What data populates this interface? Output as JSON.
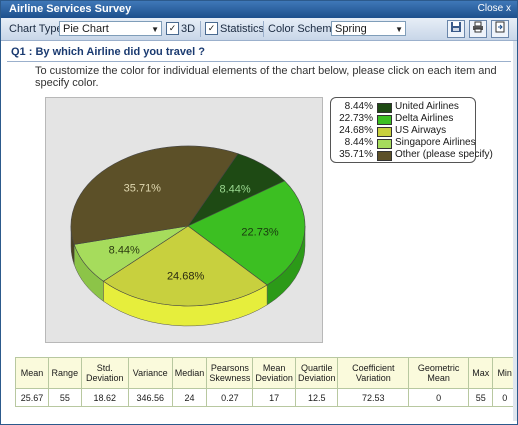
{
  "window": {
    "title": "Airline Services Survey",
    "close_label": "Close x"
  },
  "toolbar": {
    "chart_type_label": "Chart Type:",
    "chart_type_value": "Pie Chart",
    "three_d_label": "3D",
    "three_d_checked": true,
    "statistics_label": "Statistics",
    "statistics_checked": true,
    "color_scheme_label": "Color Scheme:",
    "color_scheme_value": "Spring",
    "check_mark": "✓",
    "dropdown_arrow": "▼",
    "icons": [
      "save-icon",
      "print-icon",
      "export-icon"
    ]
  },
  "question": {
    "text": "Q1 : By which Airline did you travel ?",
    "instruction": "To customize the color for individual elements of the chart below, please click on each item and specify color."
  },
  "chart_data": {
    "type": "pie",
    "three_d": true,
    "labels": [
      "United Airlines",
      "Delta Airlines",
      "US Airways",
      "Singapore Airlines",
      "Other (please specify)"
    ],
    "values": [
      8.44,
      22.73,
      24.68,
      8.44,
      35.71
    ],
    "value_labels": [
      "8.44%",
      "22.73%",
      "24.68%",
      "8.44%",
      "35.71%"
    ],
    "colors": [
      "#1e4a14",
      "#3cbf22",
      "#c8d03e",
      "#a6dc5c",
      "#5c5028"
    ],
    "side_colors": [
      "#143a0e",
      "#2c9a18",
      "#e6ee3c",
      "#8cc448",
      "#4a4020"
    ],
    "label_colors": [
      "#9ad890",
      "#1a3a10",
      "#2a2a10",
      "#2a3a10",
      "#e0d8b0"
    ],
    "legend_placement": "right"
  },
  "statistics": {
    "headers": [
      "Mean",
      "Range",
      "Std. Deviation",
      "Variance",
      "Median",
      "Pearsons Skewness",
      "Mean Deviation",
      "Quartile Deviation",
      "Coefficient Variation",
      "Geometric Mean",
      "Max",
      "Min"
    ],
    "values": [
      "25.67",
      "55",
      "18.62",
      "346.56",
      "24",
      "0.27",
      "17",
      "12.5",
      "72.53",
      "0",
      "55",
      "0"
    ]
  }
}
